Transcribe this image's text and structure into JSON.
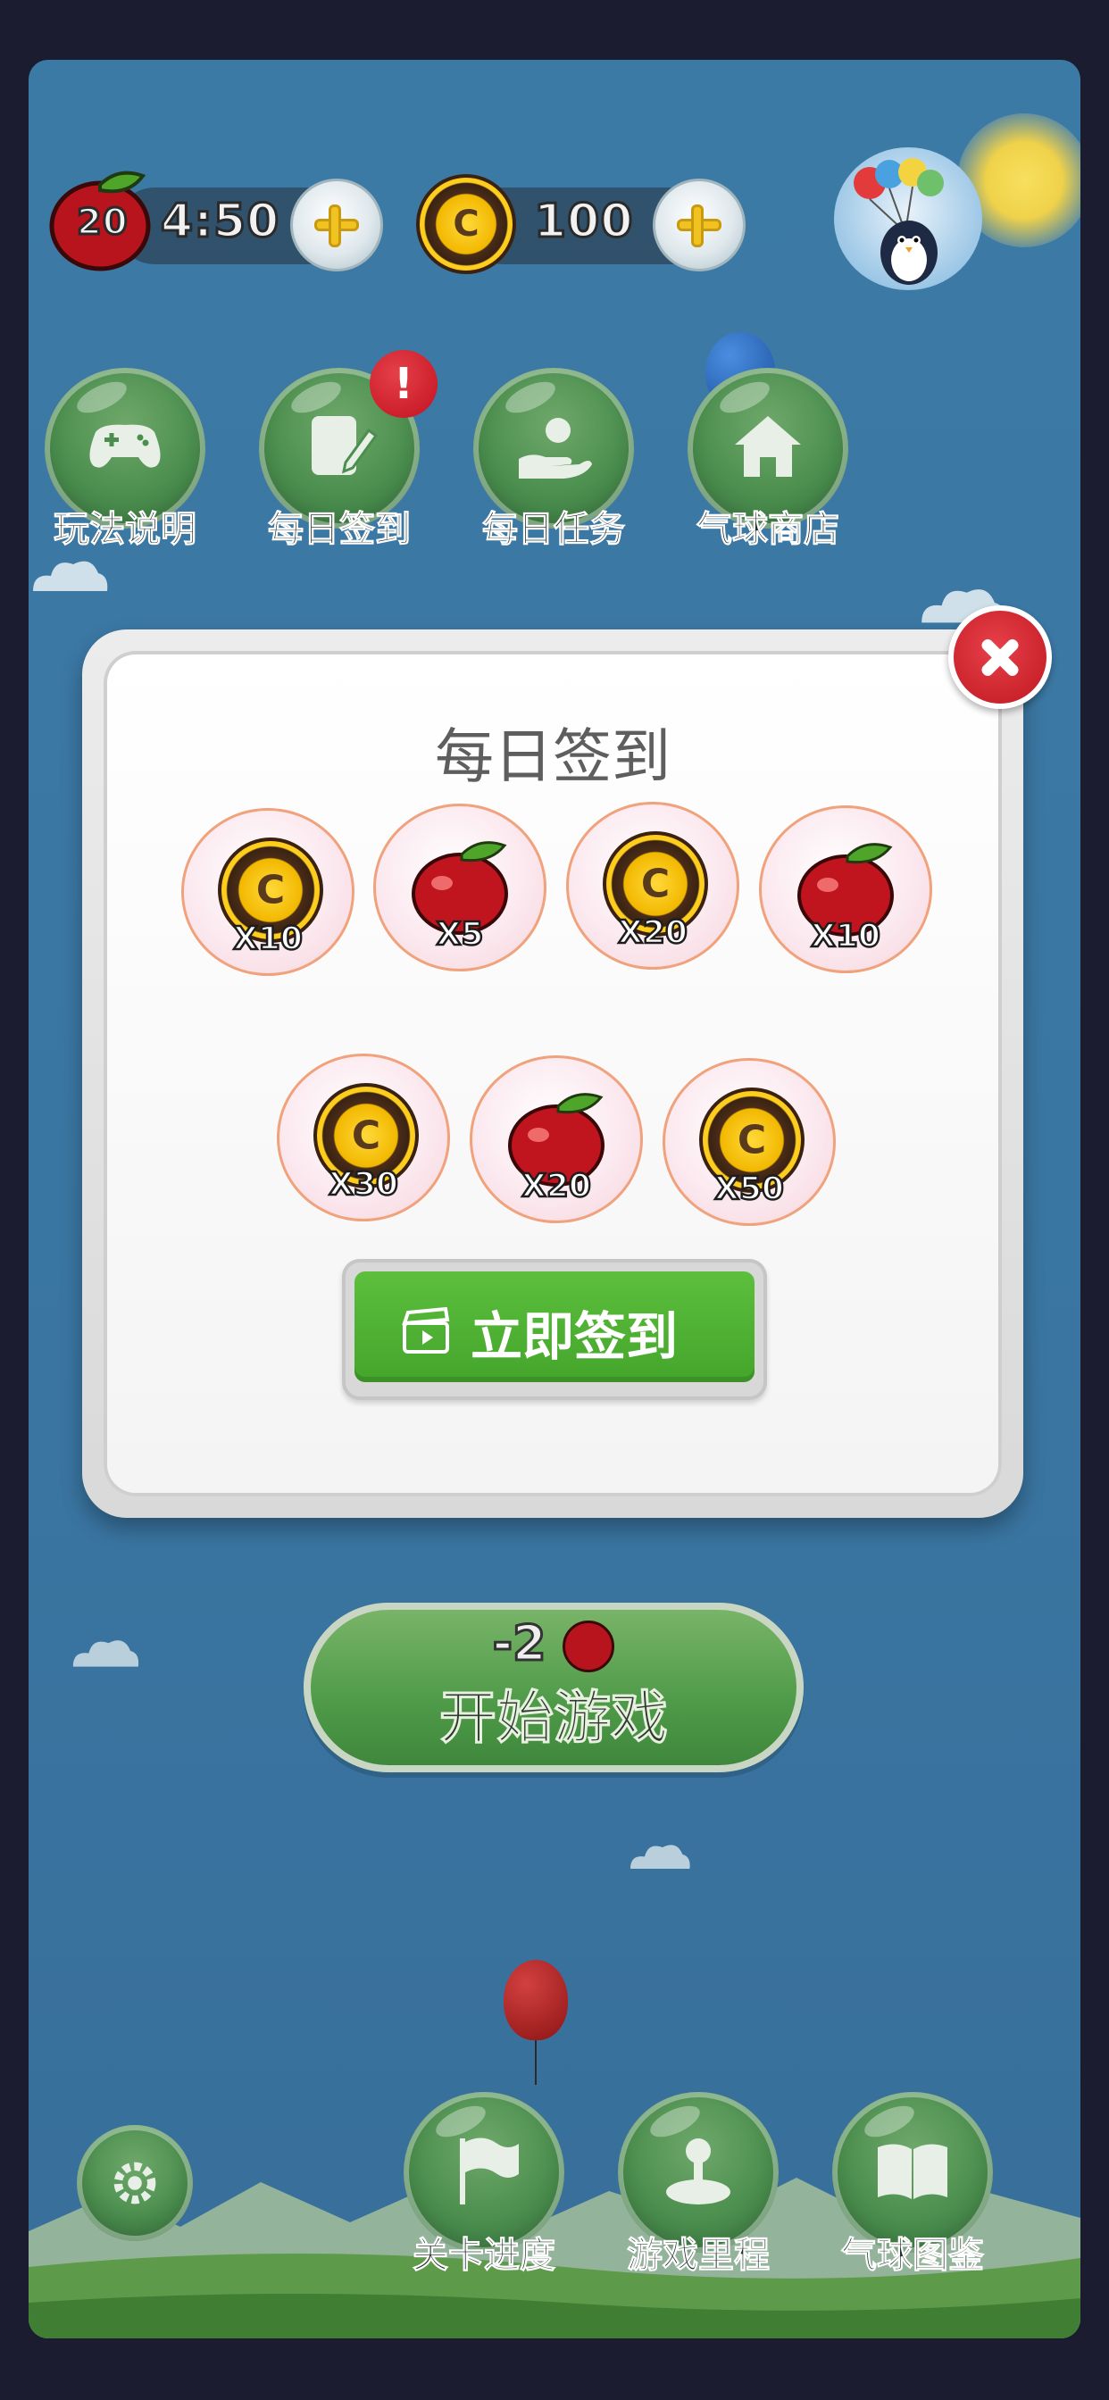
{
  "hud": {
    "apples_count": "20",
    "timer": "4:50",
    "coins": "100"
  },
  "features": [
    {
      "label": "玩法说明",
      "icon": "gamepad-icon"
    },
    {
      "label": "每日签到",
      "icon": "pencil-note-icon",
      "alert": "!"
    },
    {
      "label": "每日任务",
      "icon": "hand-person-icon"
    },
    {
      "label": "气球商店",
      "icon": "house-icon"
    }
  ],
  "start": {
    "cost": "-2",
    "label": "开始游戏"
  },
  "bottom": [
    {
      "label": "关卡进度",
      "icon": "flag-icon"
    },
    {
      "label": "游戏里程",
      "icon": "joystick-icon"
    },
    {
      "label": "气球图鉴",
      "icon": "open-book-icon"
    }
  ],
  "modal": {
    "title": "每日签到",
    "rewards": [
      {
        "type": "coin",
        "qty": "X10"
      },
      {
        "type": "apple",
        "qty": "X5"
      },
      {
        "type": "coin",
        "qty": "X20"
      },
      {
        "type": "apple",
        "qty": "X10"
      },
      {
        "type": "coin",
        "qty": "X30"
      },
      {
        "type": "apple",
        "qty": "X20"
      },
      {
        "type": "coin",
        "qty": "X50"
      }
    ],
    "signin_button": "立即签到"
  },
  "colors": {
    "sky": "#3c7aa6",
    "button_green": "#44a52c",
    "close_red": "#c01820",
    "coin_gold": "#f2b800"
  }
}
